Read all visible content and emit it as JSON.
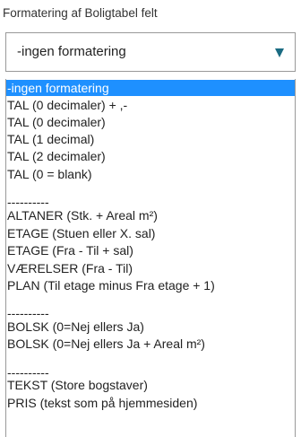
{
  "field": {
    "label": "Formatering af Boligtabel felt",
    "selected_value": "-ingen formatering"
  },
  "colors": {
    "highlight": "#1e90ff",
    "caret": "#1a6b82",
    "border": "#999999"
  },
  "icons": {
    "caret": "chevron-down-icon"
  },
  "options": [
    {
      "label": "-ingen formatering",
      "selected": true
    },
    {
      "label": "TAL (0 decimaler) + ,-"
    },
    {
      "label": "TAL (0 decimaler)"
    },
    {
      "label": "TAL (1 decimal)"
    },
    {
      "label": "TAL (2 decimaler)"
    },
    {
      "label": "TAL (0 = blank)"
    },
    {
      "label": "----------"
    },
    {
      "label": "ALTANER (Stk. + Areal m²)"
    },
    {
      "label": "ETAGE (Stuen eller X. sal)"
    },
    {
      "label": "ETAGE (Fra - Til + sal)"
    },
    {
      "label": "VÆRELSER (Fra - Til)"
    },
    {
      "label": "PLAN (Til etage minus Fra etage + 1)"
    },
    {
      "label": "----------"
    },
    {
      "label": "BOLSK (0=Nej ellers Ja)"
    },
    {
      "label": "BOLSK (0=Nej ellers Ja + Areal m²)"
    },
    {
      "label": "----------"
    },
    {
      "label": "TEKST (Store bogstaver)"
    },
    {
      "label": "PRIS (tekst som på hjemmesiden)"
    }
  ]
}
